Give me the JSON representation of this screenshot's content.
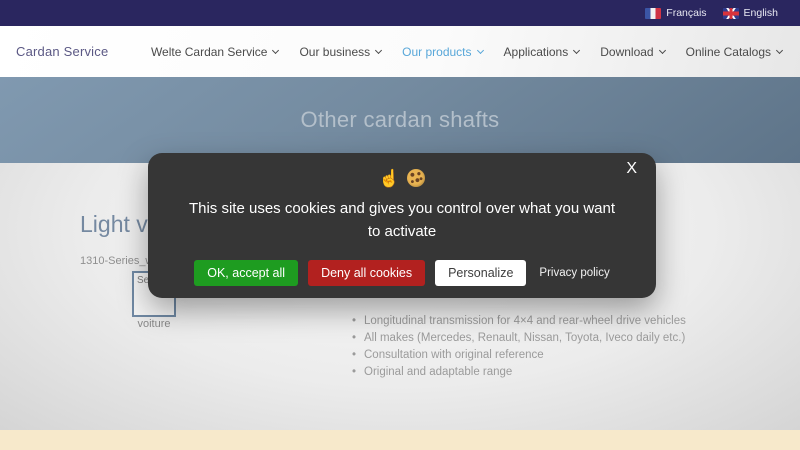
{
  "topbar": {
    "languages": [
      {
        "label": "Français",
        "icon": "flag-france-icon"
      },
      {
        "label": "English",
        "icon": "flag-uk-icon"
      }
    ]
  },
  "header": {
    "logo": "Cardan Service",
    "nav": [
      {
        "label": "Welte Cardan Service",
        "has_dropdown": true,
        "active": false
      },
      {
        "label": "Our business",
        "has_dropdown": true,
        "active": false
      },
      {
        "label": "Our products",
        "has_dropdown": true,
        "active": true
      },
      {
        "label": "Applications",
        "has_dropdown": true,
        "active": false
      },
      {
        "label": "Download",
        "has_dropdown": true,
        "active": false
      },
      {
        "label": "Online Catalogs",
        "has_dropdown": true,
        "active": false
      }
    ]
  },
  "banner": {
    "title": "Other cardan shafts"
  },
  "content": {
    "heading_visible": "Light ve",
    "file_label": "1310-Series_we",
    "thumb_alt_fragment": "Se",
    "thumb_caption": "voiture",
    "bullets": [
      "Longitudinal transmission for 4×4 and rear-wheel drive vehicles",
      "All makes (Mercedes, Renault, Nissan, Toyota, Iveco daily etc.)",
      "Consultation with original reference",
      "Original and adaptable range"
    ]
  },
  "cookie_dialog": {
    "close_label": "X",
    "icons": [
      "pointing-hand-icon",
      "cookie-icon"
    ],
    "message": "This site uses cookies and gives you control over what you want to activate",
    "buttons": [
      {
        "label": "OK, accept all",
        "color": "#1e9c20"
      },
      {
        "label": "Deny all cookies",
        "color": "#b2211f"
      },
      {
        "label": "Personalize",
        "color": "#ffffff"
      }
    ],
    "link": "Privacy policy"
  },
  "colors": {
    "topbar_bg": "#2a265f",
    "banner_gradient_start": "#8099b0",
    "banner_gradient_end": "#5e7489",
    "banner_title": "#b3bfca",
    "nav_active": "#58a7d9",
    "modal_bg": "#363636",
    "footer_band": "#f7e9cb",
    "accent_green": "#1e9c20",
    "accent_red": "#b2211f"
  }
}
